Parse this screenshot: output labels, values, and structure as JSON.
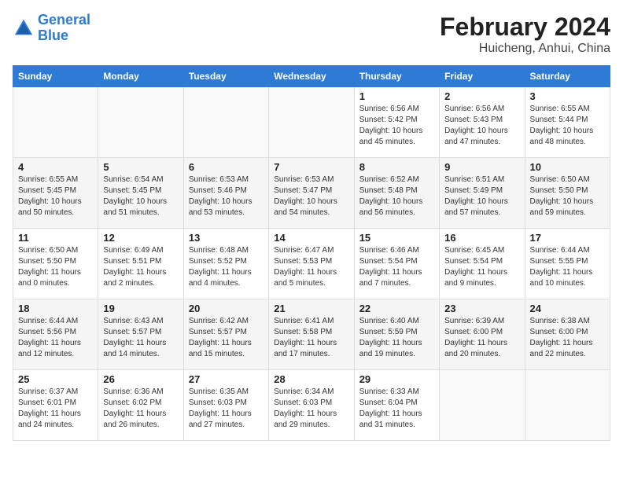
{
  "header": {
    "logo_line1": "General",
    "logo_line2": "Blue",
    "title": "February 2024",
    "subtitle": "Huicheng, Anhui, China"
  },
  "weekdays": [
    "Sunday",
    "Monday",
    "Tuesday",
    "Wednesday",
    "Thursday",
    "Friday",
    "Saturday"
  ],
  "weeks": [
    [
      {
        "day": "",
        "sunrise": "",
        "sunset": "",
        "daylight": ""
      },
      {
        "day": "",
        "sunrise": "",
        "sunset": "",
        "daylight": ""
      },
      {
        "day": "",
        "sunrise": "",
        "sunset": "",
        "daylight": ""
      },
      {
        "day": "",
        "sunrise": "",
        "sunset": "",
        "daylight": ""
      },
      {
        "day": "1",
        "sunrise": "6:56 AM",
        "sunset": "5:42 PM",
        "daylight": "10 hours and 45 minutes."
      },
      {
        "day": "2",
        "sunrise": "6:56 AM",
        "sunset": "5:43 PM",
        "daylight": "10 hours and 47 minutes."
      },
      {
        "day": "3",
        "sunrise": "6:55 AM",
        "sunset": "5:44 PM",
        "daylight": "10 hours and 48 minutes."
      }
    ],
    [
      {
        "day": "4",
        "sunrise": "6:55 AM",
        "sunset": "5:45 PM",
        "daylight": "10 hours and 50 minutes."
      },
      {
        "day": "5",
        "sunrise": "6:54 AM",
        "sunset": "5:45 PM",
        "daylight": "10 hours and 51 minutes."
      },
      {
        "day": "6",
        "sunrise": "6:53 AM",
        "sunset": "5:46 PM",
        "daylight": "10 hours and 53 minutes."
      },
      {
        "day": "7",
        "sunrise": "6:53 AM",
        "sunset": "5:47 PM",
        "daylight": "10 hours and 54 minutes."
      },
      {
        "day": "8",
        "sunrise": "6:52 AM",
        "sunset": "5:48 PM",
        "daylight": "10 hours and 56 minutes."
      },
      {
        "day": "9",
        "sunrise": "6:51 AM",
        "sunset": "5:49 PM",
        "daylight": "10 hours and 57 minutes."
      },
      {
        "day": "10",
        "sunrise": "6:50 AM",
        "sunset": "5:50 PM",
        "daylight": "10 hours and 59 minutes."
      }
    ],
    [
      {
        "day": "11",
        "sunrise": "6:50 AM",
        "sunset": "5:50 PM",
        "daylight": "11 hours and 0 minutes."
      },
      {
        "day": "12",
        "sunrise": "6:49 AM",
        "sunset": "5:51 PM",
        "daylight": "11 hours and 2 minutes."
      },
      {
        "day": "13",
        "sunrise": "6:48 AM",
        "sunset": "5:52 PM",
        "daylight": "11 hours and 4 minutes."
      },
      {
        "day": "14",
        "sunrise": "6:47 AM",
        "sunset": "5:53 PM",
        "daylight": "11 hours and 5 minutes."
      },
      {
        "day": "15",
        "sunrise": "6:46 AM",
        "sunset": "5:54 PM",
        "daylight": "11 hours and 7 minutes."
      },
      {
        "day": "16",
        "sunrise": "6:45 AM",
        "sunset": "5:54 PM",
        "daylight": "11 hours and 9 minutes."
      },
      {
        "day": "17",
        "sunrise": "6:44 AM",
        "sunset": "5:55 PM",
        "daylight": "11 hours and 10 minutes."
      }
    ],
    [
      {
        "day": "18",
        "sunrise": "6:44 AM",
        "sunset": "5:56 PM",
        "daylight": "11 hours and 12 minutes."
      },
      {
        "day": "19",
        "sunrise": "6:43 AM",
        "sunset": "5:57 PM",
        "daylight": "11 hours and 14 minutes."
      },
      {
        "day": "20",
        "sunrise": "6:42 AM",
        "sunset": "5:57 PM",
        "daylight": "11 hours and 15 minutes."
      },
      {
        "day": "21",
        "sunrise": "6:41 AM",
        "sunset": "5:58 PM",
        "daylight": "11 hours and 17 minutes."
      },
      {
        "day": "22",
        "sunrise": "6:40 AM",
        "sunset": "5:59 PM",
        "daylight": "11 hours and 19 minutes."
      },
      {
        "day": "23",
        "sunrise": "6:39 AM",
        "sunset": "6:00 PM",
        "daylight": "11 hours and 20 minutes."
      },
      {
        "day": "24",
        "sunrise": "6:38 AM",
        "sunset": "6:00 PM",
        "daylight": "11 hours and 22 minutes."
      }
    ],
    [
      {
        "day": "25",
        "sunrise": "6:37 AM",
        "sunset": "6:01 PM",
        "daylight": "11 hours and 24 minutes."
      },
      {
        "day": "26",
        "sunrise": "6:36 AM",
        "sunset": "6:02 PM",
        "daylight": "11 hours and 26 minutes."
      },
      {
        "day": "27",
        "sunrise": "6:35 AM",
        "sunset": "6:03 PM",
        "daylight": "11 hours and 27 minutes."
      },
      {
        "day": "28",
        "sunrise": "6:34 AM",
        "sunset": "6:03 PM",
        "daylight": "11 hours and 29 minutes."
      },
      {
        "day": "29",
        "sunrise": "6:33 AM",
        "sunset": "6:04 PM",
        "daylight": "11 hours and 31 minutes."
      },
      {
        "day": "",
        "sunrise": "",
        "sunset": "",
        "daylight": ""
      },
      {
        "day": "",
        "sunrise": "",
        "sunset": "",
        "daylight": ""
      }
    ]
  ],
  "labels": {
    "sunrise_prefix": "Sunrise: ",
    "sunset_prefix": "Sunset: ",
    "daylight_prefix": "Daylight: "
  }
}
